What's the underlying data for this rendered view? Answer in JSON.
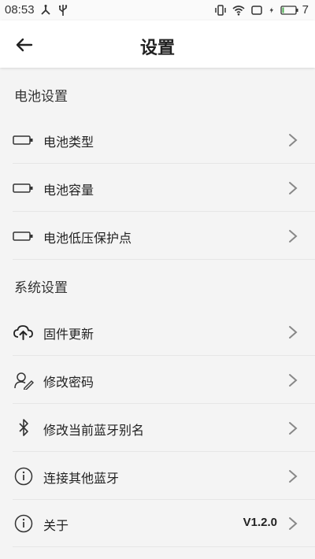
{
  "status_bar": {
    "time": "08:53",
    "battery_level": "7",
    "icons": [
      "usb-debug-icon",
      "usb-icon",
      "vibrate-icon",
      "wifi-icon",
      "screen-icon",
      "charging-icon",
      "battery-icon"
    ]
  },
  "nav": {
    "title": "设置",
    "back_icon": "arrow-left-icon"
  },
  "sections": {
    "battery": {
      "header": "电池设置",
      "items": [
        {
          "label": "电池类型",
          "icon": "battery-icon"
        },
        {
          "label": "电池容量",
          "icon": "battery-icon"
        },
        {
          "label": "电池低压保护点",
          "icon": "battery-icon"
        }
      ]
    },
    "system": {
      "header": "系统设置",
      "items": [
        {
          "label": "固件更新",
          "icon": "cloud-upload-icon"
        },
        {
          "label": "修改密码",
          "icon": "user-edit-icon"
        },
        {
          "label": "修改当前蓝牙别名",
          "icon": "bluetooth-icon"
        },
        {
          "label": "连接其他蓝牙",
          "icon": "info-icon"
        },
        {
          "label": "关于",
          "icon": "info-icon",
          "value": "V1.2.0"
        }
      ]
    }
  },
  "colors": {
    "background": "#f4f4f4",
    "nav_background": "#ffffff",
    "divider": "#e6e6e6",
    "chevron": "#888888"
  }
}
